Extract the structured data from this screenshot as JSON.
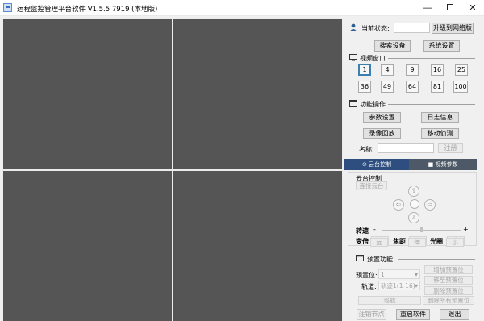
{
  "window": {
    "title": "远程监控管理平台软件 V1.5.5.7919 (本地版)",
    "min": "—",
    "close": "✕"
  },
  "video": {
    "panes": 4
  },
  "status": {
    "label": "当前状态:",
    "value": "",
    "upgrade_button": "升级到网络版",
    "search_button": "搜索设备",
    "settings_button": "系统设置"
  },
  "video_window": {
    "title": "视频窗口",
    "counts": [
      "1",
      "4",
      "9",
      "16",
      "25",
      "36",
      "49",
      "64",
      "81",
      "100"
    ],
    "selected": "1"
  },
  "functions": {
    "title": "功能操作",
    "param_button": "参数设置",
    "log_button": "日志信息",
    "playback_button": "录像回放",
    "motion_button": "移动侦测",
    "name_label": "名称:",
    "name_value": "",
    "register_button": "注册"
  },
  "tabs": {
    "ptz": "云台控制",
    "video_params": "视频参数"
  },
  "ptz": {
    "title": "云台控制",
    "connect_button": "连接云台",
    "up": "⇧",
    "down": "⇩",
    "left": "⇦",
    "right": "⇨",
    "speed_label": "转速",
    "minus": "-",
    "plus": "+",
    "zoom_label": "变倍",
    "zoom_near": "近",
    "zoom_far": "远",
    "focus_label": "焦距",
    "focus_shrink": "缩",
    "focus_stretch": "伸",
    "iris_label": "光圈",
    "iris_large": "大",
    "iris_small": "小"
  },
  "preset": {
    "title": "预置功能",
    "preset_label": "预置位:",
    "preset_value": "1",
    "add_button": "增加预置位",
    "move_button": "移至预置位",
    "track_label": "轨道:",
    "track_value": "轨迹1(1-16)",
    "delete_button": "删除预置位",
    "cruise_button": "巡航",
    "delete_all_button": "删除所有预置位"
  },
  "footer": {
    "logout_button": "注销节点",
    "restart_button": "重启软件",
    "exit_button": "退出"
  }
}
